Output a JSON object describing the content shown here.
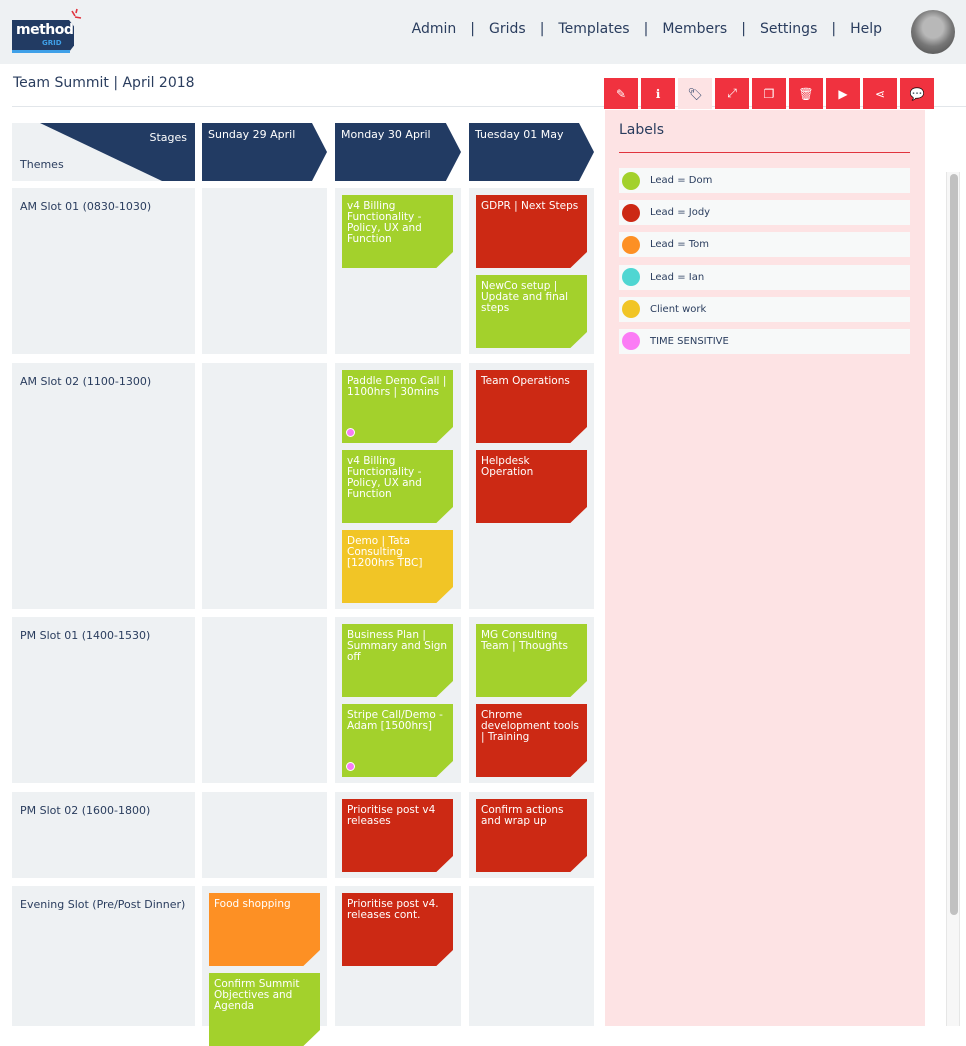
{
  "header": {
    "logo_text": "method",
    "logo_subtext": "GRID",
    "nav": [
      "Admin",
      "Grids",
      "Templates",
      "Members",
      "Settings",
      "Help"
    ],
    "nav_separator": "|"
  },
  "page": {
    "title": "Team Summit | April 2018"
  },
  "toolbar": {
    "buttons": [
      {
        "icon": "pencil-icon",
        "glyph": "✎"
      },
      {
        "icon": "info-icon",
        "glyph": "ℹ"
      },
      {
        "icon": "tags-icon",
        "glyph": "🏷"
      },
      {
        "icon": "expand-icon",
        "glyph": "⤢"
      },
      {
        "icon": "copy-icon",
        "glyph": "❐"
      },
      {
        "icon": "trash-icon",
        "glyph": "🗑"
      },
      {
        "icon": "play-icon",
        "glyph": "▶"
      },
      {
        "icon": "share-icon",
        "glyph": "⋖"
      },
      {
        "icon": "comment-icon",
        "glyph": "💬"
      }
    ]
  },
  "labels_panel": {
    "title": "Labels",
    "items": [
      {
        "name": "Lead = Dom",
        "color": "#a3d12c"
      },
      {
        "name": "Lead = Jody",
        "color": "#cc2914"
      },
      {
        "name": "Lead = Tom",
        "color": "#fd9024"
      },
      {
        "name": "Lead = Ian",
        "color": "#4fd6d2"
      },
      {
        "name": "Client work",
        "color": "#f1c526"
      },
      {
        "name": "TIME SENSITIVE",
        "color": "#fb7cf5"
      }
    ]
  },
  "grid": {
    "corner": {
      "stages": "Stages",
      "themes": "Themes"
    },
    "stages": [
      "Sunday 29 April",
      "Monday 30 April",
      "Tuesday 01 May"
    ],
    "themes": [
      "AM Slot 01 (0830-1030)",
      "AM Slot 02 (1100-1300)",
      "PM Slot 01 (1400-1530)",
      "PM Slot 02 (1600-1800)",
      "Evening Slot (Pre/Post Dinner)"
    ],
    "cards": [
      {
        "theme": 0,
        "stage": 1,
        "slot": 0,
        "text": "v4 Billing Functionality - Policy, UX and Function",
        "color": "#a3d12c"
      },
      {
        "theme": 0,
        "stage": 2,
        "slot": 0,
        "text": "GDPR | Next Steps",
        "color": "#cc2914"
      },
      {
        "theme": 0,
        "stage": 2,
        "slot": 1,
        "text": "NewCo setup | Update and final steps",
        "color": "#a3d12c"
      },
      {
        "theme": 1,
        "stage": 1,
        "slot": 0,
        "text": "Paddle Demo Call | 1100hrs | 30mins",
        "color": "#a3d12c",
        "time_sensitive": true
      },
      {
        "theme": 1,
        "stage": 1,
        "slot": 1,
        "text": "v4 Billing Functionality - Policy, UX and Function",
        "color": "#a3d12c"
      },
      {
        "theme": 1,
        "stage": 1,
        "slot": 2,
        "text": "Demo | Tata Consulting [1200hrs TBC]",
        "color": "#f1c526"
      },
      {
        "theme": 1,
        "stage": 2,
        "slot": 0,
        "text": "Team Operations",
        "color": "#cc2914"
      },
      {
        "theme": 1,
        "stage": 2,
        "slot": 1,
        "text": "Helpdesk Operation",
        "color": "#cc2914"
      },
      {
        "theme": 2,
        "stage": 1,
        "slot": 0,
        "text": "Business Plan | Summary and Sign off",
        "color": "#a3d12c"
      },
      {
        "theme": 2,
        "stage": 1,
        "slot": 1,
        "text": "Stripe Call/Demo - Adam [1500hrs]",
        "color": "#a3d12c",
        "time_sensitive": true
      },
      {
        "theme": 2,
        "stage": 2,
        "slot": 0,
        "text": "MG Consulting Team | Thoughts",
        "color": "#a3d12c"
      },
      {
        "theme": 2,
        "stage": 2,
        "slot": 1,
        "text": "Chrome development tools | Training",
        "color": "#cc2914"
      },
      {
        "theme": 3,
        "stage": 1,
        "slot": 0,
        "text": "Prioritise post v4 releases",
        "color": "#cc2914"
      },
      {
        "theme": 3,
        "stage": 2,
        "slot": 0,
        "text": "Confirm actions and wrap up",
        "color": "#cc2914"
      },
      {
        "theme": 4,
        "stage": 0,
        "slot": 0,
        "text": "Food shopping",
        "color": "#fd9024"
      },
      {
        "theme": 4,
        "stage": 0,
        "slot": 1,
        "text": "Confirm Summit Objectives and Agenda",
        "color": "#a3d12c"
      },
      {
        "theme": 4,
        "stage": 1,
        "slot": 0,
        "text": "Prioritise post v4. releases cont.",
        "color": "#cc2914"
      }
    ]
  }
}
